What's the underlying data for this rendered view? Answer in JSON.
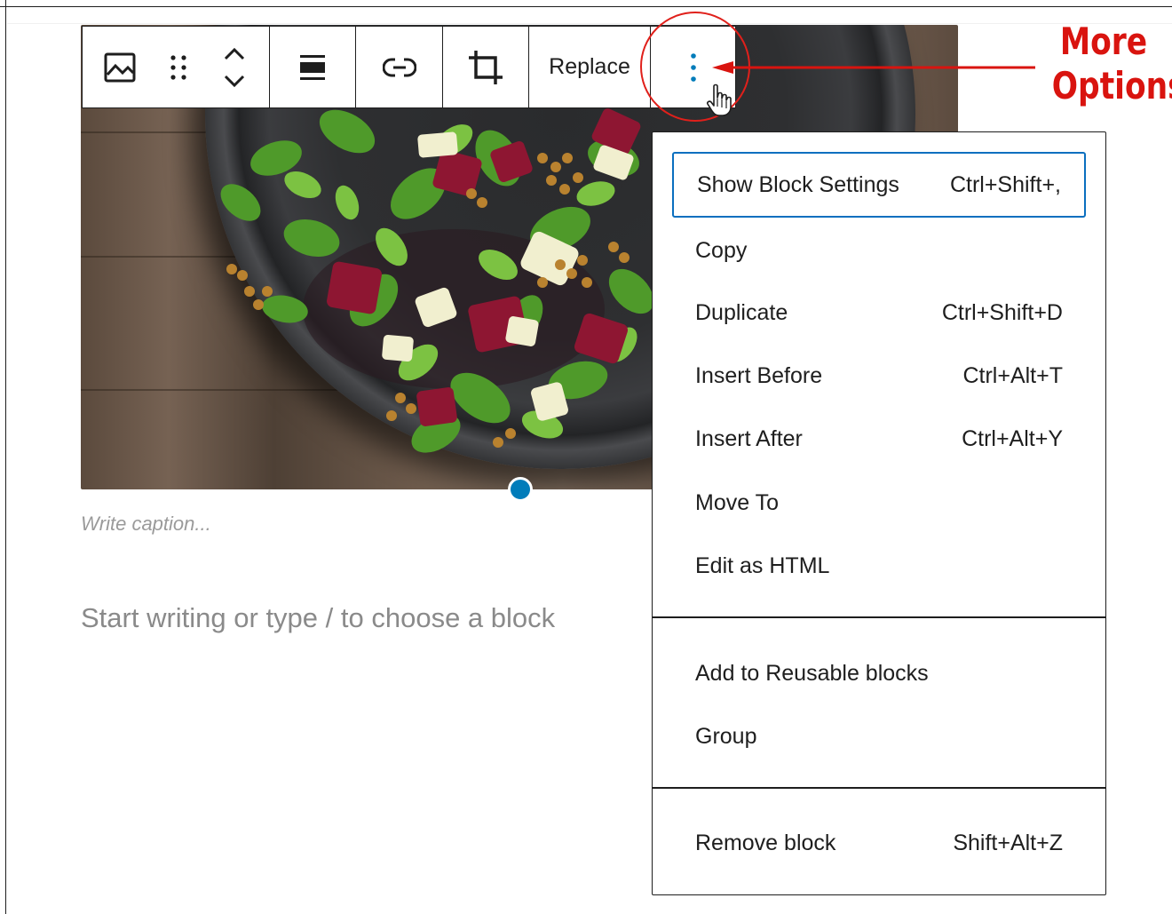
{
  "toolbar": {
    "replace_label": "Replace",
    "icons": [
      "image-icon",
      "drag-handle-icon",
      "move-up-down-icon",
      "align-icon",
      "link-icon",
      "crop-icon",
      "more-options-icon"
    ]
  },
  "block": {
    "caption_placeholder": "Write caption...",
    "appender_placeholder": "Start writing or type / to choose a block"
  },
  "menu": {
    "group1": [
      {
        "label": "Show Block Settings",
        "shortcut": "Ctrl+Shift+,"
      },
      {
        "label": "Copy",
        "shortcut": ""
      },
      {
        "label": "Duplicate",
        "shortcut": "Ctrl+Shift+D"
      },
      {
        "label": "Insert Before",
        "shortcut": "Ctrl+Alt+T"
      },
      {
        "label": "Insert After",
        "shortcut": "Ctrl+Alt+Y"
      },
      {
        "label": "Move To",
        "shortcut": ""
      },
      {
        "label": "Edit as HTML",
        "shortcut": ""
      }
    ],
    "group2": [
      {
        "label": "Add to Reusable blocks"
      },
      {
        "label": "Group"
      }
    ],
    "group3": [
      {
        "label": "Remove block",
        "shortcut": "Shift+Alt+Z"
      }
    ]
  },
  "annotation": {
    "line1": "More",
    "line2": "Options",
    "color": "#d9140f"
  },
  "colors": {
    "accent": "#007cba",
    "focus_border": "#0a6fbf",
    "text": "#1e1e1e",
    "placeholder": "#8a8a8a"
  }
}
